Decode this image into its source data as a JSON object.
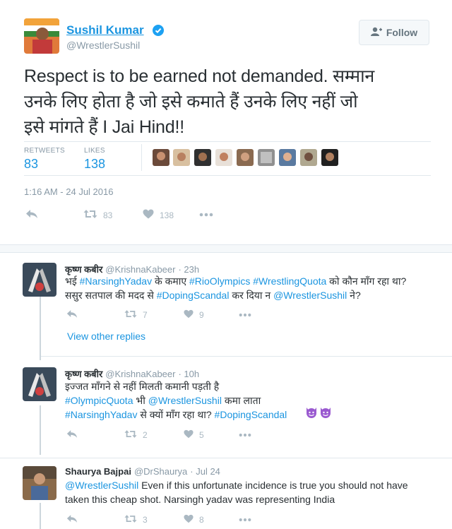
{
  "tweet": {
    "display_name": "Sushil Kumar",
    "handle": "@WrestlerSushil",
    "follow_label": "Follow",
    "text_lines": [
      "Respect is to be earned not demanded. सम्मान",
      "उनके लिए होता है जो इसे कमाते हैं उनके लिए नहीं जो",
      "इसे मांगते हैं I Jai Hind!!"
    ],
    "retweets_label": "RETWEETS",
    "retweets_count": "83",
    "likes_label": "LIKES",
    "likes_count": "138",
    "timestamp": "1:16 AM - 24 Jul 2016",
    "actions": {
      "retweets": "83",
      "likes": "138"
    }
  },
  "replies": [
    {
      "name": "कृष्ण कबीर",
      "handle": "@KrishnaKabeer",
      "time": "· 23h",
      "lines": [
        [
          {
            "t": "भई ",
            "link": false
          },
          {
            "t": "#NarsinghYadav",
            "link": true
          },
          {
            "t": " के कमाए ",
            "link": false
          },
          {
            "t": "#RioOlympics",
            "link": true
          },
          {
            "t": " ",
            "link": false
          },
          {
            "t": "#WrestlingQuota",
            "link": true
          },
          {
            "t": " को कौन माँग रहा था?",
            "link": false
          }
        ],
        [
          {
            "t": "ससुर सतपाल की मदद से ",
            "link": false
          },
          {
            "t": "#DopingScandal",
            "link": true
          },
          {
            "t": " कर दिया न ",
            "link": false
          },
          {
            "t": "@WrestlerSushil",
            "link": true
          },
          {
            "t": " ने?",
            "link": false
          }
        ]
      ],
      "retweets": "7",
      "likes": "9",
      "view_other": "View other replies"
    },
    {
      "name": "कृष्ण कबीर",
      "handle": "@KrishnaKabeer",
      "time": "· 10h",
      "lines": [
        [
          {
            "t": "इज्जत माँगने से नहीं मिलती कमानी पड़ती है",
            "link": false
          }
        ],
        [
          {
            "t": "#OlympicQuota",
            "link": true
          },
          {
            "t": " भी ",
            "link": false
          },
          {
            "t": "@WrestlerSushil",
            "link": true
          },
          {
            "t": " कमा लाता",
            "link": false
          }
        ],
        [
          {
            "t": "#NarsinghYadav",
            "link": true
          },
          {
            "t": " से क्यों माँग रहा था? ",
            "link": false
          },
          {
            "t": "#DopingScandal",
            "link": true
          }
        ]
      ],
      "retweets": "2",
      "likes": "5"
    },
    {
      "name": "Shaurya Bajpai",
      "handle": "@DrShaurya",
      "time": "· Jul 24",
      "lines": [
        [
          {
            "t": "@WrestlerSushil",
            "link": true
          },
          {
            "t": " Even if this unfortunate incidence is true  you should not have",
            "link": false
          }
        ],
        [
          {
            "t": "taken this cheap shot. Narsingh yadav was representing India",
            "link": false
          }
        ]
      ],
      "retweets": "3",
      "likes": "8"
    }
  ],
  "colors": {
    "link": "#1b95e0",
    "muted": "#8899a6",
    "action": "#aab8c2",
    "text": "#292f33"
  },
  "icons": [
    "verified-icon",
    "follow-user-icon",
    "reply-icon",
    "retweet-icon",
    "like-icon",
    "more-icon",
    "devil-emoji-icon"
  ]
}
